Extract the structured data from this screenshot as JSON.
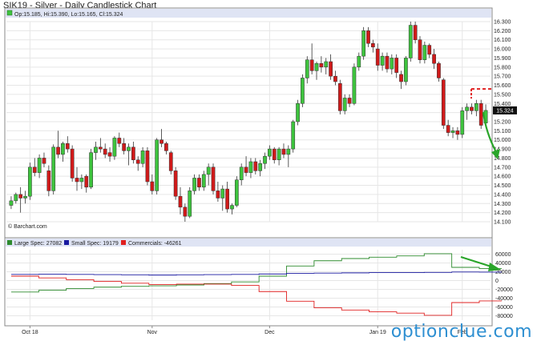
{
  "header": {
    "title": "SIK19 - Silver - Daily Candlestick Chart",
    "ohlc_label": "Op:15.185, Hi:15.390, Lo:15.165, Cl:15.324",
    "current_price": "15.324",
    "credit": "© Barchart.com"
  },
  "legend": {
    "large_spec": "Large Spec: 27082",
    "small_spec": "Small Spec: 19179",
    "commercials": "Commercials: -46261"
  },
  "colors": {
    "up": "#3ec43e",
    "down": "#d01a1a",
    "large_spec": "#2e8b2e",
    "small_spec": "#1a1aa0",
    "commercials": "#e02020",
    "arrow": "#2aa52a",
    "dashed": "#e02020",
    "header_bg": "#dfe4f4"
  },
  "watermark": "optionclue.com",
  "chart_data": [
    {
      "type": "candlestick",
      "title": "SIK19 - Silver - Daily Candlestick Chart",
      "ylim": [
        14.1,
        16.3
      ],
      "y_ticks": [
        "16.300",
        "16.200",
        "16.100",
        "16.000",
        "15.900",
        "15.800",
        "15.700",
        "15.600",
        "15.500",
        "15.400",
        "15.300",
        "15.200",
        "15.100",
        "15.000",
        "14.900",
        "14.800",
        "14.700",
        "14.600",
        "14.500",
        "14.400",
        "14.300",
        "14.200",
        "14.100"
      ],
      "x_tick_labels": [
        "Oct 18",
        "Nov",
        "Dec",
        "Jan 19",
        "Feb"
      ],
      "candles": [
        {
          "o": 14.28,
          "h": 14.38,
          "l": 14.24,
          "c": 14.33
        },
        {
          "o": 14.33,
          "h": 14.42,
          "l": 14.3,
          "c": 14.4
        },
        {
          "o": 14.4,
          "h": 14.48,
          "l": 14.2,
          "c": 14.36
        },
        {
          "o": 14.36,
          "h": 14.44,
          "l": 14.3,
          "c": 14.38
        },
        {
          "o": 14.38,
          "h": 14.75,
          "l": 14.34,
          "c": 14.7
        },
        {
          "o": 14.7,
          "h": 14.8,
          "l": 14.6,
          "c": 14.64
        },
        {
          "o": 14.64,
          "h": 14.84,
          "l": 14.58,
          "c": 14.8
        },
        {
          "o": 14.8,
          "h": 14.86,
          "l": 14.7,
          "c": 14.74
        },
        {
          "o": 14.66,
          "h": 14.72,
          "l": 14.38,
          "c": 14.44
        },
        {
          "o": 14.44,
          "h": 14.95,
          "l": 14.4,
          "c": 14.92
        },
        {
          "o": 14.92,
          "h": 15.1,
          "l": 14.8,
          "c": 14.84
        },
        {
          "o": 14.84,
          "h": 14.98,
          "l": 14.76,
          "c": 14.96
        },
        {
          "o": 14.96,
          "h": 15.04,
          "l": 14.86,
          "c": 14.9
        },
        {
          "o": 14.9,
          "h": 14.94,
          "l": 14.54,
          "c": 14.58
        },
        {
          "o": 14.58,
          "h": 14.7,
          "l": 14.44,
          "c": 14.54
        },
        {
          "o": 14.54,
          "h": 14.62,
          "l": 14.46,
          "c": 14.58
        },
        {
          "o": 14.6,
          "h": 14.62,
          "l": 14.42,
          "c": 14.48
        },
        {
          "o": 14.48,
          "h": 14.9,
          "l": 14.46,
          "c": 14.86
        },
        {
          "o": 14.86,
          "h": 14.98,
          "l": 14.78,
          "c": 14.92
        },
        {
          "o": 14.92,
          "h": 15.02,
          "l": 14.86,
          "c": 14.9
        },
        {
          "o": 14.9,
          "h": 14.96,
          "l": 14.8,
          "c": 14.84
        },
        {
          "o": 14.86,
          "h": 14.92,
          "l": 14.76,
          "c": 14.82
        },
        {
          "o": 14.82,
          "h": 15.04,
          "l": 14.78,
          "c": 15.02
        },
        {
          "o": 15.02,
          "h": 15.08,
          "l": 14.92,
          "c": 14.96
        },
        {
          "o": 14.96,
          "h": 15.02,
          "l": 14.84,
          "c": 14.88
        },
        {
          "o": 14.88,
          "h": 14.96,
          "l": 14.72,
          "c": 14.92
        },
        {
          "o": 14.92,
          "h": 14.98,
          "l": 14.74,
          "c": 14.78
        },
        {
          "o": 14.78,
          "h": 14.82,
          "l": 14.66,
          "c": 14.74
        },
        {
          "o": 14.74,
          "h": 14.92,
          "l": 14.7,
          "c": 14.88
        },
        {
          "o": 14.88,
          "h": 14.92,
          "l": 14.5,
          "c": 14.54
        },
        {
          "o": 14.54,
          "h": 14.62,
          "l": 14.4,
          "c": 14.44
        },
        {
          "o": 14.44,
          "h": 15.02,
          "l": 14.4,
          "c": 15.0
        },
        {
          "o": 15.0,
          "h": 15.12,
          "l": 14.92,
          "c": 14.96
        },
        {
          "o": 14.96,
          "h": 14.98,
          "l": 14.84,
          "c": 14.88
        },
        {
          "o": 14.86,
          "h": 14.88,
          "l": 14.62,
          "c": 14.66
        },
        {
          "o": 14.66,
          "h": 14.7,
          "l": 14.34,
          "c": 14.38
        },
        {
          "o": 14.38,
          "h": 14.48,
          "l": 14.18,
          "c": 14.26
        },
        {
          "o": 14.26,
          "h": 14.3,
          "l": 14.1,
          "c": 14.16
        },
        {
          "o": 14.16,
          "h": 14.48,
          "l": 14.14,
          "c": 14.44
        },
        {
          "o": 14.44,
          "h": 14.62,
          "l": 14.4,
          "c": 14.58
        },
        {
          "o": 14.58,
          "h": 14.62,
          "l": 14.44,
          "c": 14.48
        },
        {
          "o": 14.48,
          "h": 14.66,
          "l": 14.44,
          "c": 14.62
        },
        {
          "o": 14.62,
          "h": 14.74,
          "l": 14.5,
          "c": 14.7
        },
        {
          "o": 14.7,
          "h": 14.74,
          "l": 14.4,
          "c": 14.44
        },
        {
          "o": 14.44,
          "h": 14.54,
          "l": 14.32,
          "c": 14.36
        },
        {
          "o": 14.36,
          "h": 14.5,
          "l": 14.22,
          "c": 14.46
        },
        {
          "o": 14.46,
          "h": 14.54,
          "l": 14.2,
          "c": 14.24
        },
        {
          "o": 14.24,
          "h": 14.3,
          "l": 14.18,
          "c": 14.28
        },
        {
          "o": 14.28,
          "h": 14.6,
          "l": 14.26,
          "c": 14.56
        },
        {
          "o": 14.56,
          "h": 14.74,
          "l": 14.5,
          "c": 14.7
        },
        {
          "o": 14.7,
          "h": 14.82,
          "l": 14.6,
          "c": 14.64
        },
        {
          "o": 14.64,
          "h": 14.8,
          "l": 14.58,
          "c": 14.76
        },
        {
          "o": 14.76,
          "h": 14.8,
          "l": 14.62,
          "c": 14.66
        },
        {
          "o": 14.66,
          "h": 14.78,
          "l": 14.6,
          "c": 14.74
        },
        {
          "o": 14.74,
          "h": 14.86,
          "l": 14.68,
          "c": 14.82
        },
        {
          "o": 14.82,
          "h": 14.94,
          "l": 14.78,
          "c": 14.9
        },
        {
          "o": 14.9,
          "h": 14.92,
          "l": 14.74,
          "c": 14.78
        },
        {
          "o": 14.78,
          "h": 14.92,
          "l": 14.72,
          "c": 14.9
        },
        {
          "o": 14.9,
          "h": 14.96,
          "l": 14.8,
          "c": 14.84
        },
        {
          "o": 14.84,
          "h": 14.94,
          "l": 14.7,
          "c": 14.9
        },
        {
          "o": 14.9,
          "h": 15.22,
          "l": 14.86,
          "c": 15.2
        },
        {
          "o": 15.2,
          "h": 15.44,
          "l": 15.16,
          "c": 15.4
        },
        {
          "o": 15.4,
          "h": 15.72,
          "l": 15.36,
          "c": 15.68
        },
        {
          "o": 15.68,
          "h": 15.92,
          "l": 15.62,
          "c": 15.88
        },
        {
          "o": 15.88,
          "h": 16.06,
          "l": 15.72,
          "c": 15.76
        },
        {
          "o": 15.76,
          "h": 15.86,
          "l": 15.66,
          "c": 15.84
        },
        {
          "o": 15.84,
          "h": 15.92,
          "l": 15.74,
          "c": 15.8
        },
        {
          "o": 15.8,
          "h": 15.9,
          "l": 15.72,
          "c": 15.86
        },
        {
          "o": 15.86,
          "h": 15.94,
          "l": 15.66,
          "c": 15.7
        },
        {
          "o": 15.7,
          "h": 15.76,
          "l": 15.6,
          "c": 15.64
        },
        {
          "o": 15.62,
          "h": 15.66,
          "l": 15.28,
          "c": 15.32
        },
        {
          "o": 15.32,
          "h": 15.5,
          "l": 15.28,
          "c": 15.46
        },
        {
          "o": 15.46,
          "h": 15.5,
          "l": 15.36,
          "c": 15.4
        },
        {
          "o": 15.4,
          "h": 15.84,
          "l": 15.38,
          "c": 15.8
        },
        {
          "o": 15.8,
          "h": 15.96,
          "l": 15.76,
          "c": 15.92
        },
        {
          "o": 15.92,
          "h": 16.24,
          "l": 15.88,
          "c": 16.2
        },
        {
          "o": 16.2,
          "h": 16.24,
          "l": 16.02,
          "c": 16.06
        },
        {
          "o": 16.06,
          "h": 16.1,
          "l": 15.96,
          "c": 16.02
        },
        {
          "o": 16.0,
          "h": 16.06,
          "l": 15.76,
          "c": 15.82
        },
        {
          "o": 15.82,
          "h": 15.96,
          "l": 15.76,
          "c": 15.92
        },
        {
          "o": 15.92,
          "h": 15.96,
          "l": 15.74,
          "c": 15.78
        },
        {
          "o": 15.78,
          "h": 15.94,
          "l": 15.72,
          "c": 15.9
        },
        {
          "o": 15.9,
          "h": 15.94,
          "l": 15.68,
          "c": 15.74
        },
        {
          "o": 15.72,
          "h": 15.76,
          "l": 15.56,
          "c": 15.64
        },
        {
          "o": 15.64,
          "h": 15.92,
          "l": 15.6,
          "c": 15.9
        },
        {
          "o": 15.9,
          "h": 16.3,
          "l": 15.86,
          "c": 16.26
        },
        {
          "o": 16.26,
          "h": 16.3,
          "l": 16.06,
          "c": 16.1
        },
        {
          "o": 16.1,
          "h": 16.14,
          "l": 15.84,
          "c": 15.88
        },
        {
          "o": 15.88,
          "h": 16.08,
          "l": 15.84,
          "c": 16.04
        },
        {
          "o": 16.04,
          "h": 16.06,
          "l": 15.9,
          "c": 15.94
        },
        {
          "o": 15.94,
          "h": 16.0,
          "l": 15.78,
          "c": 15.84
        },
        {
          "o": 15.84,
          "h": 15.86,
          "l": 15.64,
          "c": 15.68
        },
        {
          "o": 15.66,
          "h": 15.68,
          "l": 15.12,
          "c": 15.16
        },
        {
          "o": 15.16,
          "h": 15.22,
          "l": 15.04,
          "c": 15.08
        },
        {
          "o": 15.08,
          "h": 15.14,
          "l": 15.02,
          "c": 15.1
        },
        {
          "o": 15.1,
          "h": 15.14,
          "l": 15.0,
          "c": 15.06
        },
        {
          "o": 15.06,
          "h": 15.36,
          "l": 15.02,
          "c": 15.32
        },
        {
          "o": 15.32,
          "h": 15.4,
          "l": 15.22,
          "c": 15.36
        },
        {
          "o": 15.36,
          "h": 15.4,
          "l": 15.28,
          "c": 15.32
        },
        {
          "o": 15.32,
          "h": 15.44,
          "l": 15.26,
          "c": 15.4
        },
        {
          "o": 15.4,
          "h": 15.44,
          "l": 15.12,
          "c": 15.16
        },
        {
          "o": 15.185,
          "h": 15.39,
          "l": 15.165,
          "c": 15.324
        }
      ],
      "dashed_level": 15.56
    },
    {
      "type": "line",
      "title": "",
      "ylim": [
        -90000,
        70000
      ],
      "y_ticks": [
        "60000",
        "40000",
        "20000",
        "0",
        "-20000",
        "-40000",
        "-60000",
        "-80000"
      ],
      "x_tick_labels": [
        "Oct 18",
        "Nov",
        "Dec",
        "Jan 19",
        "Feb"
      ],
      "series": [
        {
          "name": "Large Spec: 27082",
          "step": true,
          "values": [
            -26000,
            -22000,
            -18000,
            -15000,
            -13000,
            -12000,
            -10000,
            -7000,
            -3000,
            10000,
            33000,
            45000,
            50000,
            53000,
            56000,
            61000,
            30000,
            27082
          ]
        },
        {
          "name": "Small Spec: 19179",
          "step": true,
          "values": [
            14000,
            14500,
            14000,
            13500,
            13000,
            12500,
            13000,
            13500,
            14000,
            15000,
            16500,
            17000,
            17500,
            18000,
            18000,
            18500,
            19500,
            19179
          ]
        },
        {
          "name": "Commercials: -46261",
          "step": true,
          "values": [
            10000,
            6000,
            2000,
            -2000,
            -6000,
            -9000,
            -8000,
            -8000,
            -11000,
            -25000,
            -47000,
            -62000,
            -67000,
            -71000,
            -74000,
            -79000,
            -50000,
            -46261
          ]
        }
      ]
    }
  ]
}
